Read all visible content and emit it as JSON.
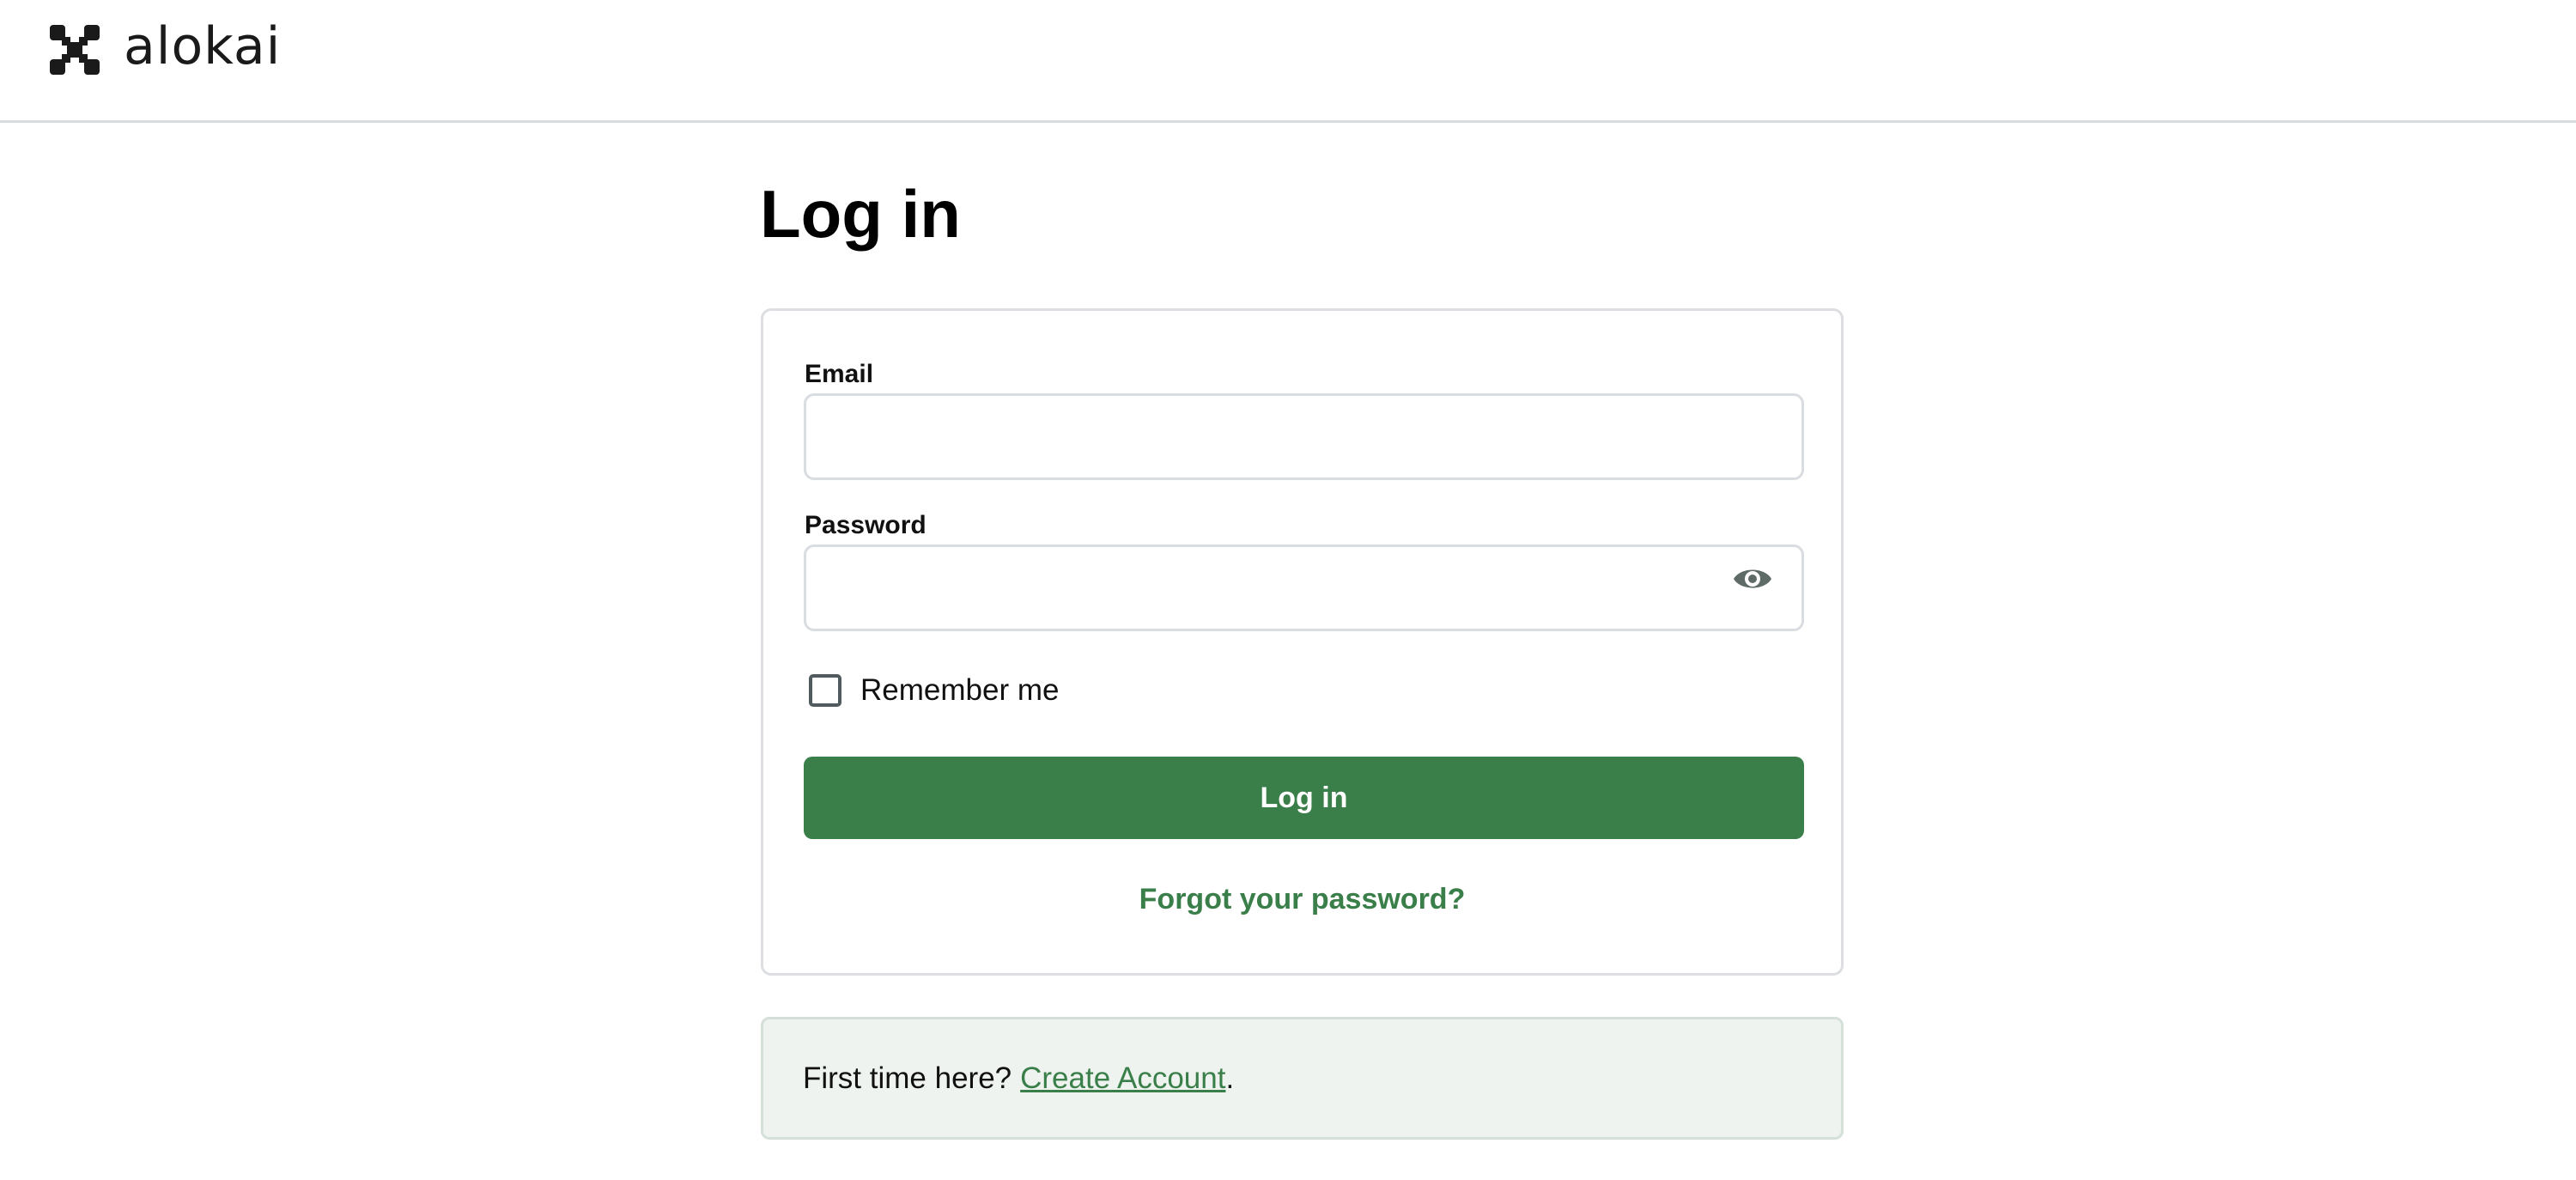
{
  "header": {
    "brand": "alokai",
    "logo_icon": "alokai-logo-icon"
  },
  "page": {
    "title": "Log in"
  },
  "form": {
    "email_label": "Email",
    "email_value": "",
    "password_label": "Password",
    "password_value": "",
    "password_toggle_icon": "eye-icon",
    "remember_label": "Remember me",
    "remember_checked": false,
    "submit_label": "Log in",
    "forgot_label": "Forgot your password?"
  },
  "signup": {
    "prompt": "First time here?",
    "link_label": "Create Account",
    "suffix": "."
  },
  "colors": {
    "accent": "#3a7f4a",
    "signup_bg": "#eef3ef",
    "border": "#dcdee2"
  }
}
